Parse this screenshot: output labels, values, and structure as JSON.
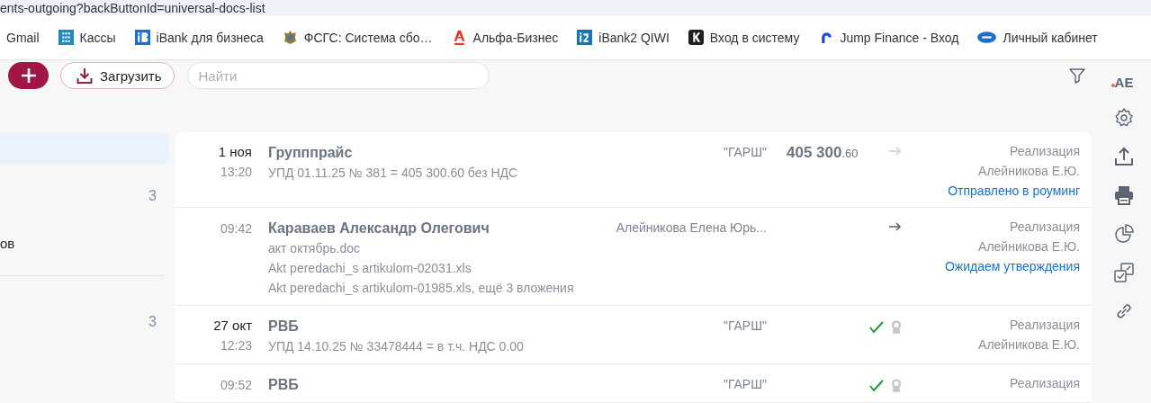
{
  "browser": {
    "address": "ents-outgoing?backButtonId=universal-docs-list",
    "bookmarks": [
      {
        "label": "Gmail",
        "kind": "none"
      },
      {
        "label": "Кассы",
        "kind": "grid"
      },
      {
        "label": "iBank для бизнеса",
        "kind": "ibank"
      },
      {
        "label": "ФСГС: Система сбо…",
        "kind": "emblem"
      },
      {
        "label": "Альфа-Бизнес",
        "kind": "alfa"
      },
      {
        "label": "iBank2 QIWI",
        "kind": "ibank2"
      },
      {
        "label": "Вход в систему",
        "kind": "k"
      },
      {
        "label": "Jump Finance - Вход",
        "kind": "jump"
      },
      {
        "label": "Личный кабинет",
        "kind": "oval"
      }
    ]
  },
  "toolbar": {
    "upload_button": "Загрузить",
    "search": {
      "placeholder": "Найти"
    }
  },
  "user": {
    "initials": "AE",
    "notification": true
  },
  "sidebar": {
    "groups": [
      [
        {
          "selected": true
        },
        {
          "count": "3",
          "selected": false
        },
        {
          "label": "ов",
          "selected": false
        }
      ],
      [
        {
          "count": "3",
          "selected": false
        }
      ]
    ]
  },
  "documents": [
    {
      "date": "1 ноя",
      "time": "13:20",
      "name": "Групппрайс",
      "lines": [
        "УПД 01.11.25 № 381 = 405 300.60 без НДС"
      ],
      "party": "\"ГАРШ\"",
      "amount": "405 300",
      "amount_fraction": ".60",
      "icons": [
        {
          "kind": "arrow",
          "dim": true
        }
      ],
      "type": "Реализация",
      "person": "Алейникова Е.Ю.",
      "status": "Отправлено в роуминг"
    },
    {
      "time": "09:42",
      "name": "Караваев Александр Олегович",
      "lines": [
        "акт октябрь.doc",
        "Akt peredachi_s artikulom-02031.xls",
        "Akt peredachi_s artikulom-01985.xls, ещё 3 вложения"
      ],
      "party": "Алейникова Елена Юрь...",
      "icons": [
        {
          "kind": "arrow",
          "dim": false
        }
      ],
      "type": "Реализация",
      "person": "Алейникова Е.Ю.",
      "status": "Ожидаем утверждения"
    },
    {
      "date": "27 окт",
      "time": "12:23",
      "name": "РВБ",
      "lines": [
        "УПД 14.10.25 № 33478444 = в т.ч. НДС 0.00"
      ],
      "party": "\"ГАРШ\"",
      "icons": [
        {
          "kind": "check",
          "dim": false
        },
        {
          "kind": "seal",
          "dim": true
        }
      ],
      "type": "Реализация",
      "person": "Алейникова Е.Ю."
    },
    {
      "time": "09:52",
      "name": "РВБ",
      "party": "\"ГАРШ\"",
      "icons": [
        {
          "kind": "check",
          "dim": false
        },
        {
          "kind": "seal",
          "dim": true
        }
      ],
      "type": "Реализация"
    }
  ]
}
